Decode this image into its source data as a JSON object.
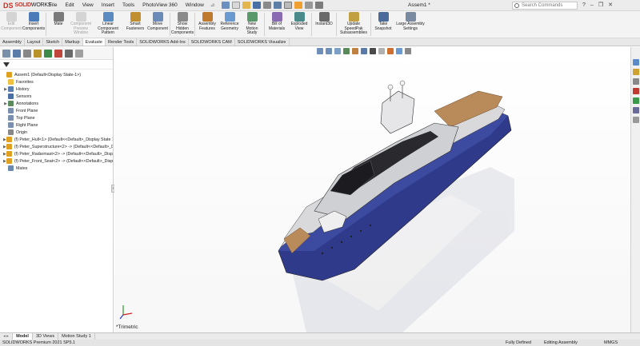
{
  "app": {
    "brand_prefix": "DS",
    "brand": "SOLID",
    "brand_suffix": "WORKS"
  },
  "menus": [
    "File",
    "Edit",
    "View",
    "Insert",
    "Tools",
    "PhotoView 360",
    "Window"
  ],
  "document_title": "Assem1 *",
  "search": {
    "placeholder": "Search Commands"
  },
  "ribbon": [
    {
      "label": "Edit Component",
      "icon": "edit-component-icon",
      "disabled": true
    },
    {
      "label": "Insert Components",
      "icon": "insert-components-icon",
      "disabled": false
    },
    {
      "label": "Mate",
      "icon": "mate-icon",
      "disabled": false
    },
    {
      "label": "Component Preview Window",
      "icon": "component-preview-icon",
      "disabled": true
    },
    {
      "label": "Linear Component Pattern",
      "icon": "linear-pattern-icon",
      "disabled": false
    },
    {
      "label": "Smart Fasteners",
      "icon": "smart-fasteners-icon",
      "disabled": false
    },
    {
      "label": "Move Component",
      "icon": "move-component-icon",
      "disabled": false
    },
    {
      "label": "Show Hidden Components",
      "icon": "show-hidden-icon",
      "disabled": false
    },
    {
      "label": "Assembly Features",
      "icon": "assembly-features-icon",
      "disabled": false
    },
    {
      "label": "Reference Geometry",
      "icon": "reference-geometry-icon",
      "disabled": false
    },
    {
      "label": "New Motion Study",
      "icon": "motion-study-icon",
      "disabled": false
    },
    {
      "label": "Bill of Materials",
      "icon": "bom-icon",
      "disabled": false
    },
    {
      "label": "Exploded View",
      "icon": "exploded-view-icon",
      "disabled": false
    },
    {
      "label": "Instant3D",
      "icon": "instant3d-icon",
      "disabled": false
    },
    {
      "label": "Update SpeedPak Subassemblies",
      "icon": "speedpak-icon",
      "disabled": false
    },
    {
      "label": "Take Snapshot",
      "icon": "snapshot-icon",
      "disabled": false
    },
    {
      "label": "Large Assembly Settings",
      "icon": "large-assembly-icon",
      "disabled": false
    }
  ],
  "tabs": [
    "Assembly",
    "Layout",
    "Sketch",
    "Markup",
    "Evaluate",
    "Render Tools",
    "SOLIDWORKS Add-Ins",
    "SOLIDWORKS CAM",
    "SOLIDWORKS Visualize"
  ],
  "active_tab": "Evaluate",
  "tree": [
    {
      "label": "Assem1  (Default<Display State-1>)",
      "icon": "assembly-icon",
      "arrow": "",
      "color": "#e0a020"
    },
    {
      "label": "Favorites",
      "icon": "favorites-icon",
      "arrow": "",
      "color": "#f0c040"
    },
    {
      "label": "History",
      "icon": "history-icon",
      "arrow": "▶",
      "color": "#5b7fb0"
    },
    {
      "label": "Sensors",
      "icon": "sensors-icon",
      "arrow": "",
      "color": "#4a6fa5"
    },
    {
      "label": "Annotations",
      "icon": "annotations-icon",
      "arrow": "▶",
      "color": "#5c8a5c"
    },
    {
      "label": "Front Plane",
      "icon": "plane-icon",
      "arrow": "",
      "color": "#7a8fb0"
    },
    {
      "label": "Top Plane",
      "icon": "plane-icon",
      "arrow": "",
      "color": "#7a8fb0"
    },
    {
      "label": "Right Plane",
      "icon": "plane-icon",
      "arrow": "",
      "color": "#7a8fb0"
    },
    {
      "label": "Origin",
      "icon": "origin-icon",
      "arrow": "",
      "color": "#888888"
    },
    {
      "label": "(f) Peter_Hull<1> (Default<<Default>_Display State 1>",
      "icon": "part-icon",
      "arrow": "▶",
      "color": "#e0a020"
    },
    {
      "label": "(f) Peter_Superstructure<2> -> (Default<<Default>_Di",
      "icon": "part-icon",
      "arrow": "▶",
      "color": "#e0a020"
    },
    {
      "label": "(f) Peter_Radarmast<2> -> (Default<<Default>_Display",
      "icon": "part-icon",
      "arrow": "▶",
      "color": "#e0a020"
    },
    {
      "label": "(f) Peter_Front_Seat<2> -> (Default<<Default>_Display",
      "icon": "part-icon",
      "arrow": "▶",
      "color": "#e0a020"
    },
    {
      "label": "Mates",
      "icon": "mates-icon",
      "arrow": "",
      "color": "#6a8ab0"
    }
  ],
  "view_label": "*Trimetric",
  "bottom_tabs": [
    "Model",
    "3D Views",
    "Motion Study 1"
  ],
  "status": {
    "version": "SOLIDWORKS Premium 2021 SP5.1",
    "state": "Fully Defined",
    "mode": "Editing Assembly",
    "units": "MMGS"
  },
  "colors": {
    "accent": "#d52b1e",
    "hull": "#2f3a8a"
  }
}
